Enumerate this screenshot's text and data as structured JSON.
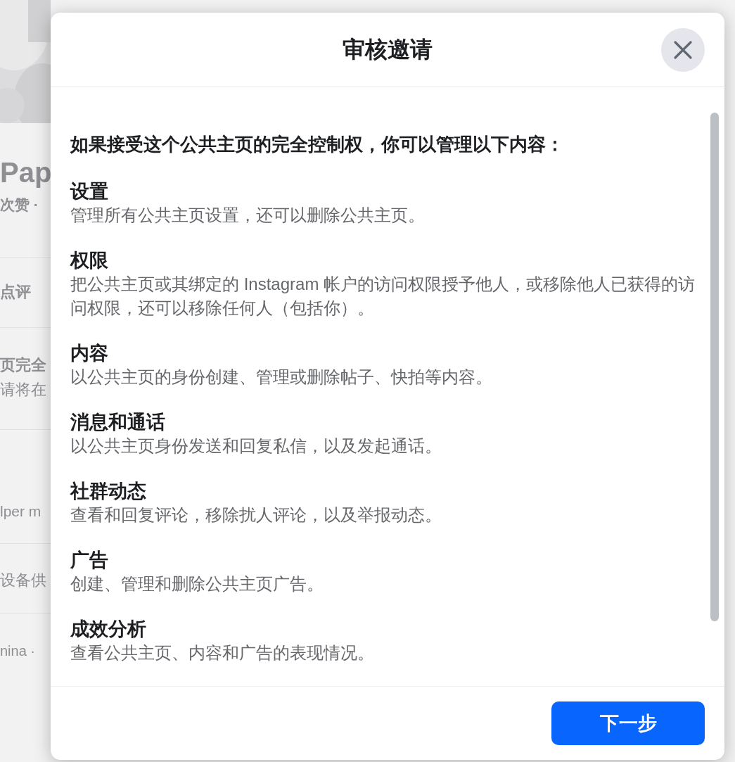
{
  "background_page": {
    "texts": [
      "Pap",
      "次赞 ·",
      "点评",
      "页完全",
      "请将在",
      "lper m",
      "设备供",
      "nina ·"
    ]
  },
  "dialog": {
    "title": "审核邀请",
    "intro": "如果接受这个公共主页的完全控制权，你可以管理以下内容：",
    "sections": [
      {
        "title": "设置",
        "description": "管理所有公共主页设置，还可以删除公共主页。"
      },
      {
        "title": "权限",
        "description": "把公共主页或其绑定的 Instagram 帐户的访问权限授予他人，或移除他人已获得的访问权限，还可以移除任何人（包括你）。"
      },
      {
        "title": "内容",
        "description": "以公共主页的身份创建、管理或删除帖子、快拍等内容。"
      },
      {
        "title": "消息和通话",
        "description": "以公共主页身份发送和回复私信，以及发起通话。"
      },
      {
        "title": "社群动态",
        "description": "查看和回复评论，移除扰人评论，以及举报动态。"
      },
      {
        "title": "广告",
        "description": "创建、管理和删除公共主页广告。"
      },
      {
        "title": "成效分析",
        "description": "查看公共主页、内容和广告的表现情况。"
      }
    ],
    "next_button": "下一步"
  }
}
